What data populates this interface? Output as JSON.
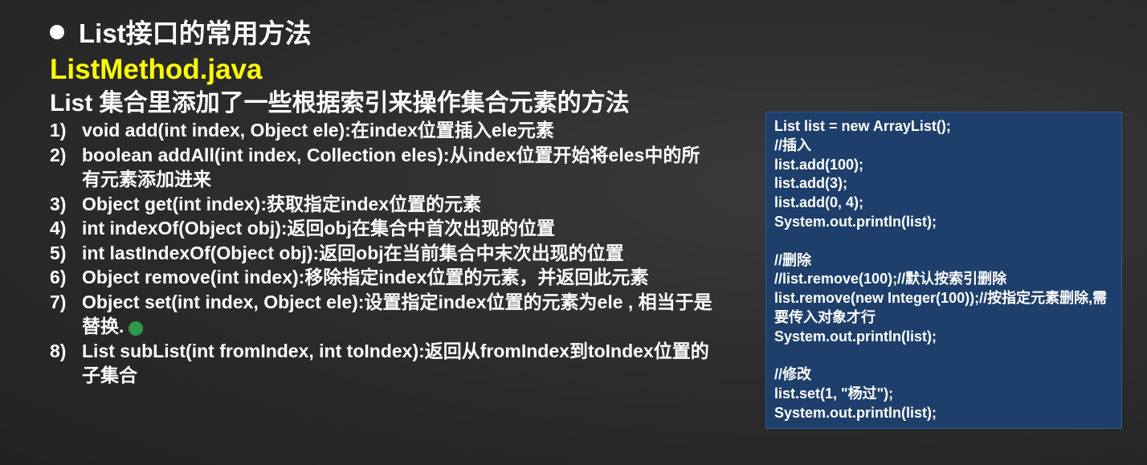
{
  "slide": {
    "heading": "List接口的常用方法",
    "filename": "ListMethod.java",
    "subtitle": "List 集合里添加了一些根据索引来操作集合元素的方法",
    "methods": [
      {
        "num": "1)",
        "text": "void add(int index, Object ele):在index位置插入ele元素"
      },
      {
        "num": "2)",
        "text": "boolean addAll(int index, Collection eles):从index位置开始将eles中的所有元素添加进来"
      },
      {
        "num": "3)",
        "text": "Object get(int index):获取指定index位置的元素"
      },
      {
        "num": "4)",
        "text": "int indexOf(Object obj):返回obj在集合中首次出现的位置"
      },
      {
        "num": "5)",
        "text": "int lastIndexOf(Object obj):返回obj在当前集合中末次出现的位置"
      },
      {
        "num": "6)",
        "text": "Object remove(int index):移除指定index位置的元素，并返回此元素"
      },
      {
        "num": "7)",
        "text": "Object set(int index, Object ele):设置指定index位置的元素为ele , 相当于是替换."
      },
      {
        "num": "8)",
        "text": "List subList(int fromIndex, int toIndex):返回从fromIndex到toIndex位置的子集合"
      }
    ],
    "code": [
      "List list = new ArrayList();",
      "//插入",
      "list.add(100);",
      "list.add(3);",
      "list.add(0, 4);",
      "System.out.println(list);",
      "",
      "//删除",
      "//list.remove(100);//默认按索引删除",
      "list.remove(new Integer(100));//按指定元素删除,需要传入对象才行",
      "System.out.println(list);",
      "",
      "//修改",
      "list.set(1, \"杨过\");",
      "System.out.println(list);"
    ]
  }
}
